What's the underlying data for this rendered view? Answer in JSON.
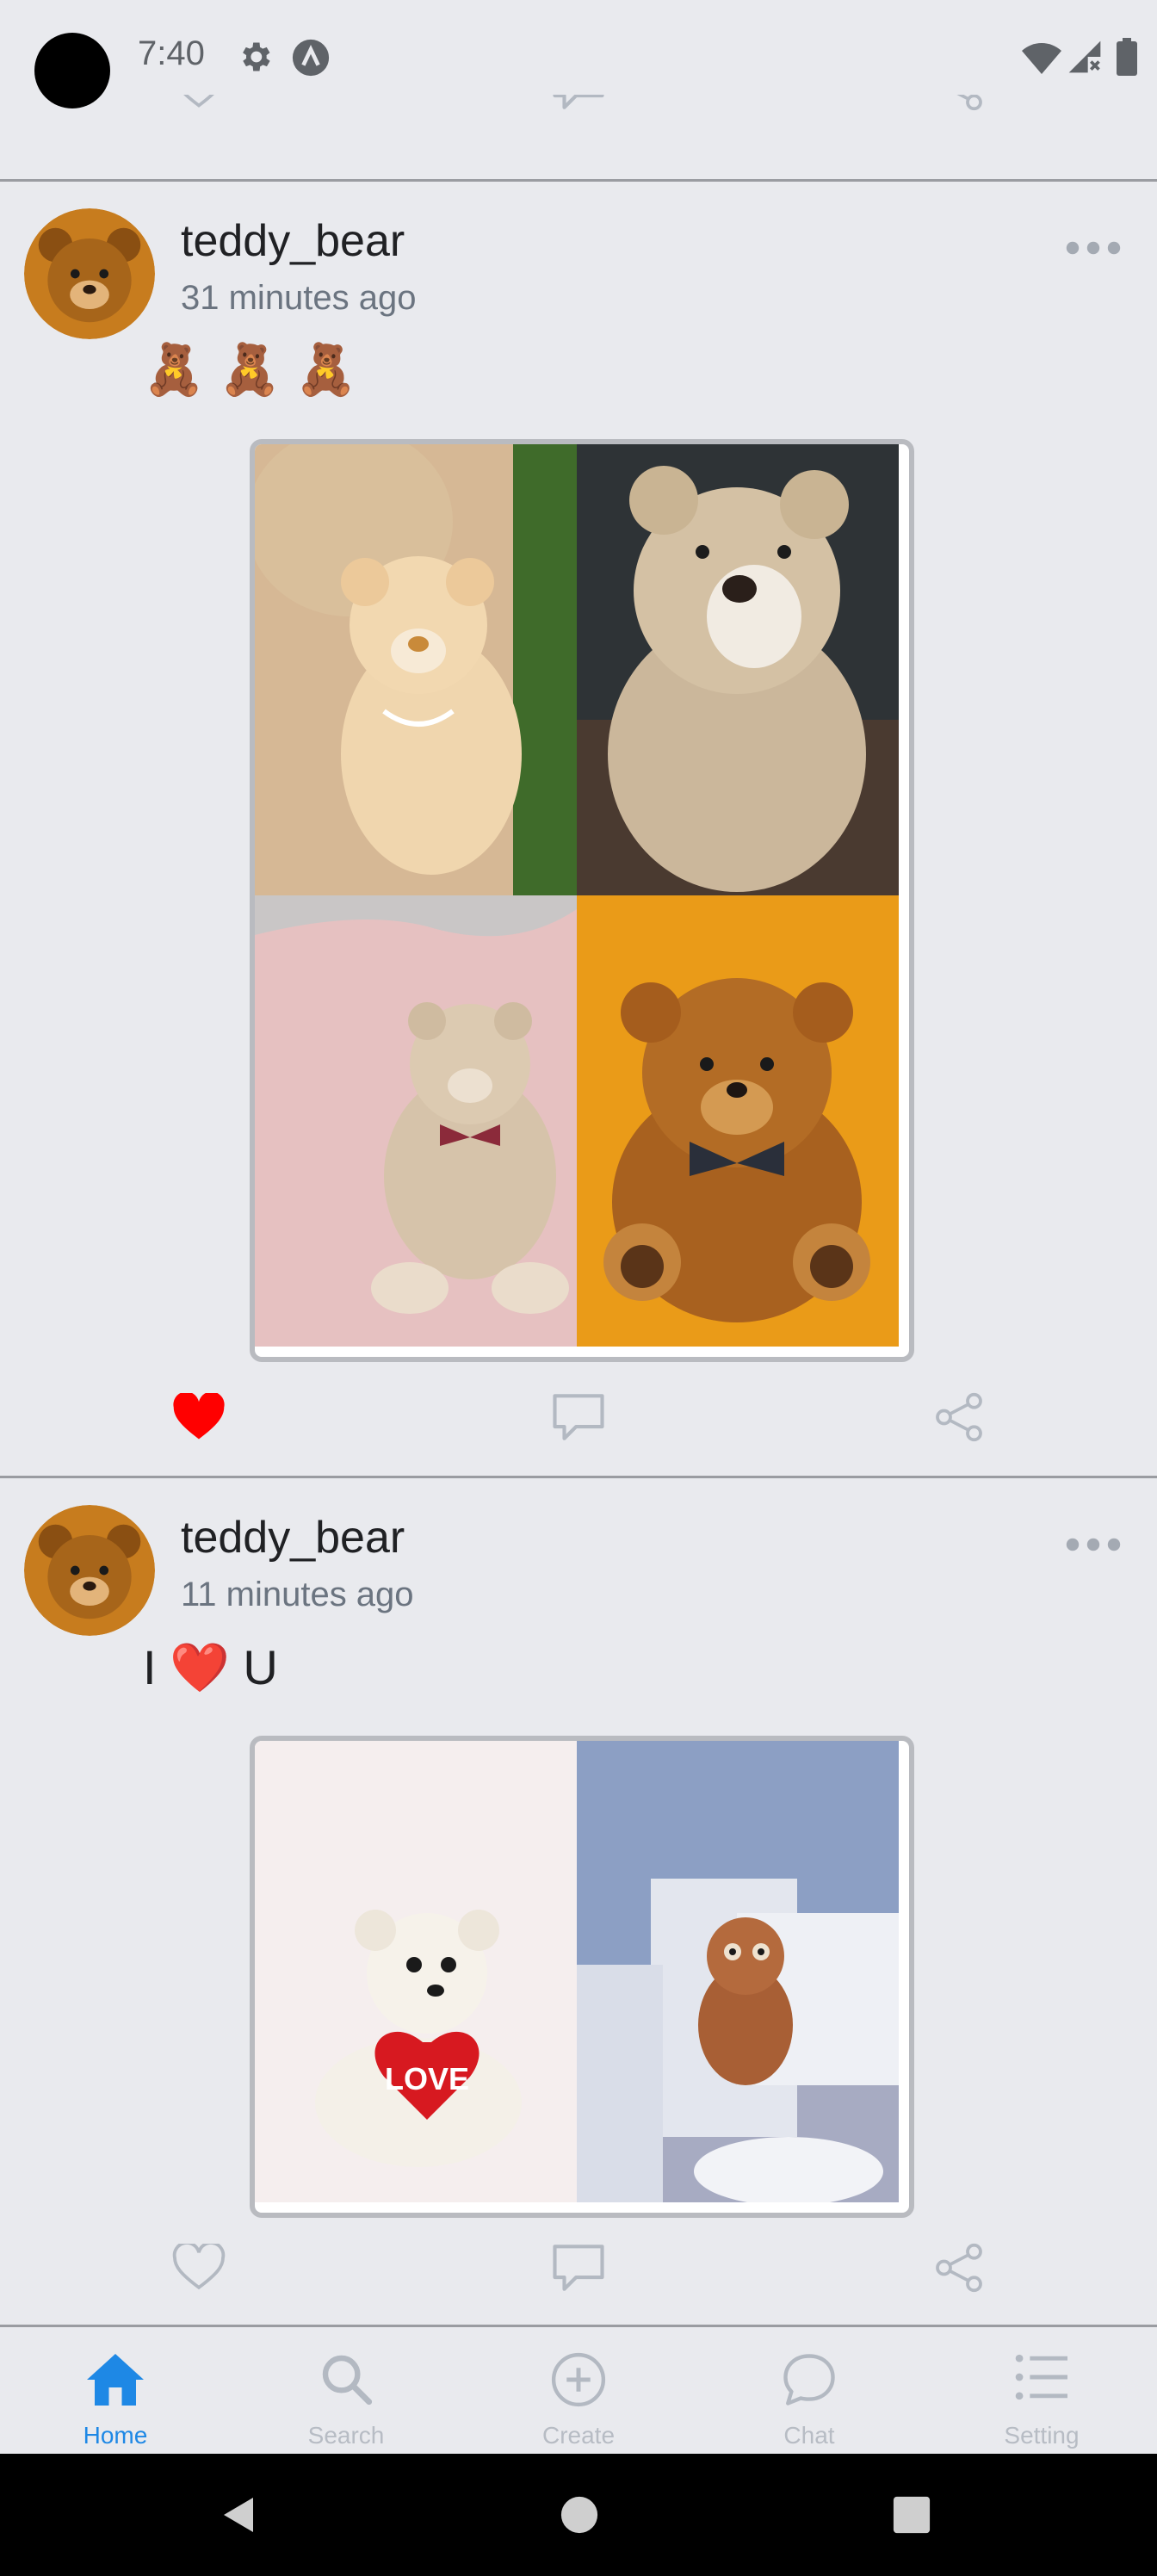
{
  "status_bar": {
    "time": "7:40"
  },
  "posts": [
    {
      "username": "teddy_bear",
      "timestamp": "31 minutes ago",
      "content": "🧸 🧸 🧸",
      "liked": true
    },
    {
      "username": "teddy_bear",
      "timestamp": "11 minutes ago",
      "content": "I ❤️ U",
      "liked": false
    }
  ],
  "tabs": [
    {
      "label": "Home",
      "icon": "home-icon",
      "active": true
    },
    {
      "label": "Search",
      "icon": "search-icon",
      "active": false
    },
    {
      "label": "Create",
      "icon": "plus-circle-icon",
      "active": false
    },
    {
      "label": "Chat",
      "icon": "chat-icon",
      "active": false
    },
    {
      "label": "Setting",
      "icon": "list-icon",
      "active": false
    }
  ],
  "colors": {
    "accent": "#1e88e5",
    "like": "#ff0000",
    "icon_gray": "#b3b9c2"
  }
}
